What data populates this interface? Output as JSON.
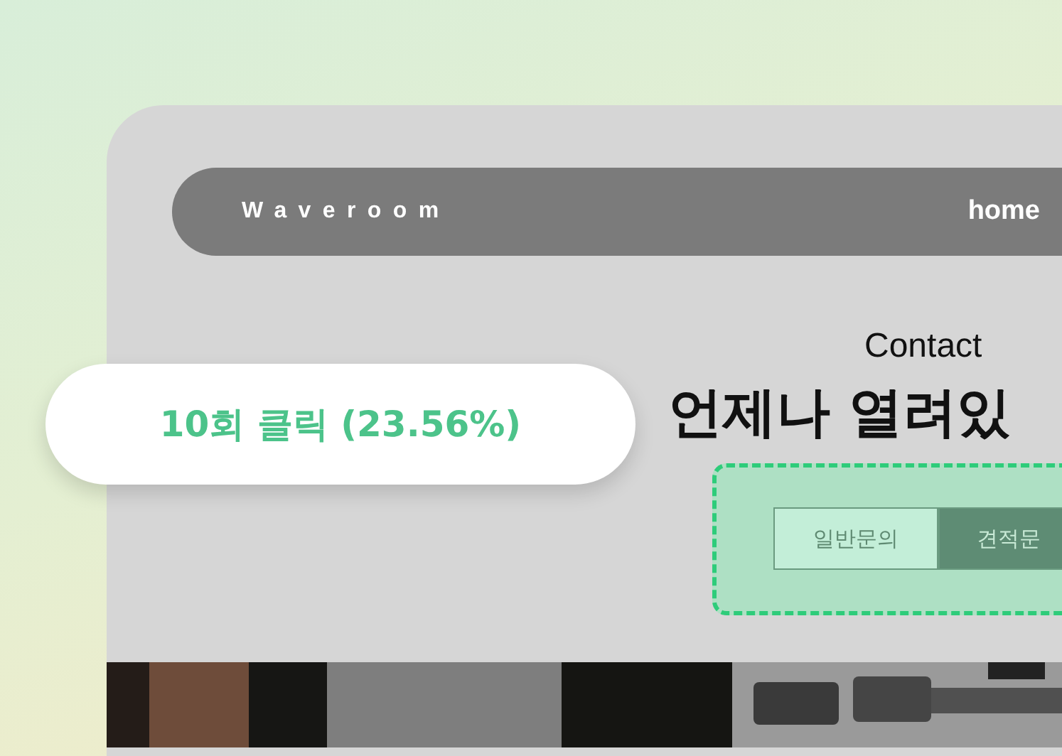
{
  "nav": {
    "logo": "Waveroom",
    "links": [
      {
        "label": "home"
      }
    ]
  },
  "contact": {
    "eyebrow": "Contact",
    "heading": "언제나 열려있",
    "tabs": [
      {
        "label": "일반문의",
        "selected": true
      },
      {
        "label": "견적문",
        "selected": false
      }
    ]
  },
  "tooltip": {
    "text": "10회 클릭 (23.56%)"
  }
}
